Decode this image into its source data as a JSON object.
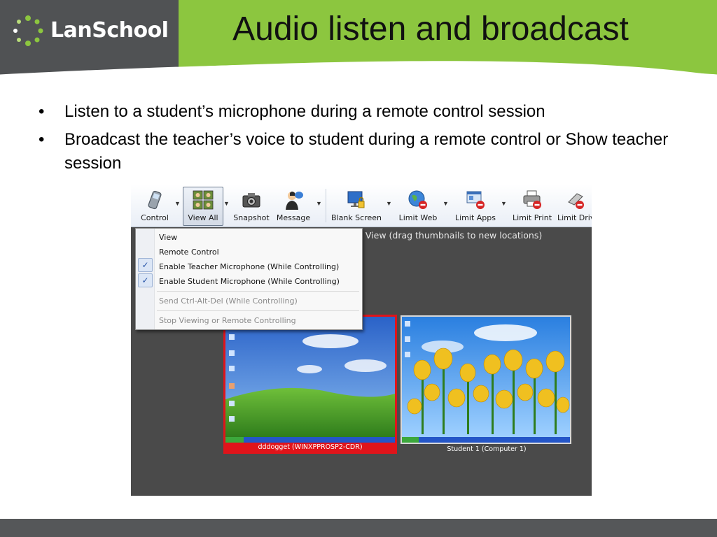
{
  "brand": {
    "logo_text": "LanSchool",
    "green": "#8cc63f",
    "gray": "#505254"
  },
  "slide": {
    "title": "Audio listen and broadcast",
    "bullets": [
      "Listen to a student’s microphone during a remote control session",
      "Broadcast the teacher’s voice to student during a remote control or Show teacher session"
    ]
  },
  "toolbar": {
    "control": "Control",
    "view_all": "View All",
    "snapshot": "Snapshot",
    "message": "Message",
    "blank_screen": "Blank Screen",
    "limit_web": "Limit Web",
    "limit_apps": "Limit Apps",
    "limit_print": "Limit Print",
    "limit_drives": "Limit Driv"
  },
  "view_caption": "t View (drag thumbnails to new locations)",
  "menu": {
    "items": [
      {
        "label": "View",
        "checked": false,
        "disabled": false
      },
      {
        "label": "Remote Control",
        "checked": false,
        "disabled": false
      },
      {
        "label": "Enable Teacher Microphone (While Controlling)",
        "checked": true,
        "disabled": false
      },
      {
        "label": "Enable Student Microphone (While Controlling)",
        "checked": true,
        "disabled": false
      },
      {
        "label": "Send Ctrl-Alt-Del (While Controlling)",
        "checked": false,
        "disabled": true
      },
      {
        "label": "Stop Viewing or Remote Controlling",
        "checked": false,
        "disabled": false
      }
    ]
  },
  "thumbnails": [
    {
      "caption": "dddogget (WINXPPROSP2-CDR)",
      "selected": true
    },
    {
      "caption": "Student 1 (Computer 1)",
      "selected": false
    }
  ]
}
